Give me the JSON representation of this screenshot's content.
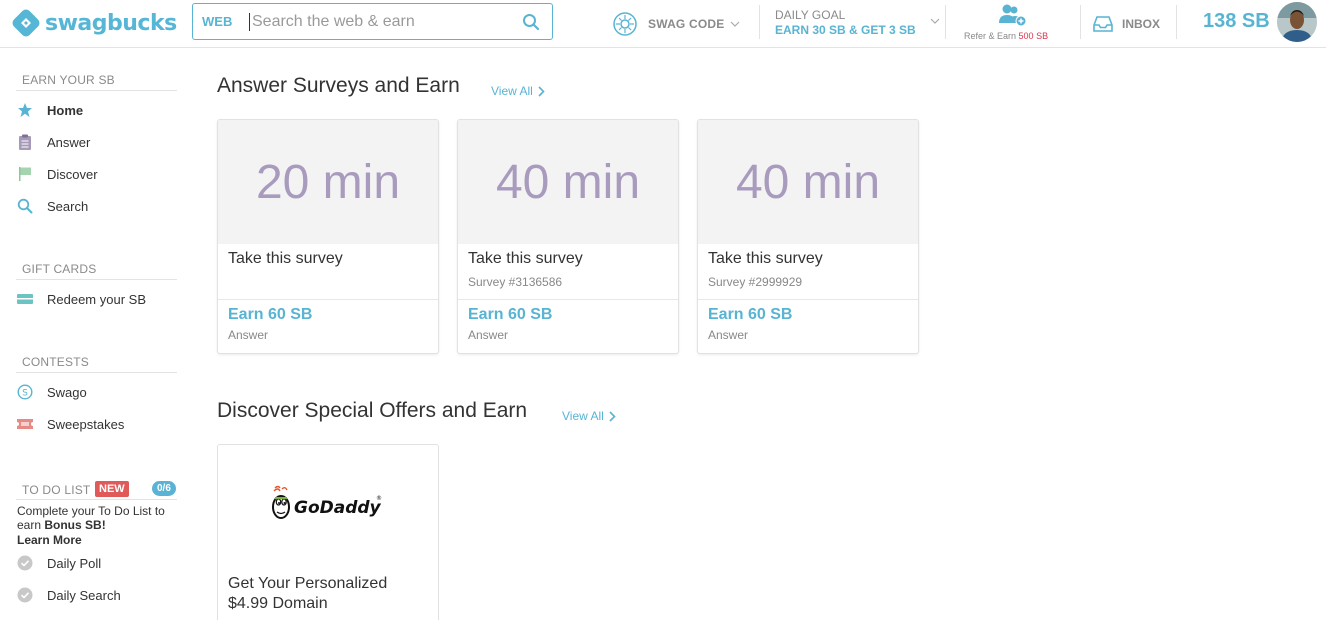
{
  "header": {
    "logo_text": "swagbucks",
    "search": {
      "scope": "WEB",
      "placeholder": "Search the web & earn"
    },
    "swag_code": {
      "label": "SWAG CODE"
    },
    "daily_goal": {
      "title": "DAILY GOAL",
      "value": "EARN 30 SB & GET 3 SB"
    },
    "refer": {
      "label": "Refer & Earn",
      "amount": "500 SB"
    },
    "inbox": {
      "label": "INBOX"
    },
    "balance": "138 SB"
  },
  "sidebar": {
    "earn_heading": "EARN YOUR SB",
    "earn_items": [
      {
        "label": "Home",
        "icon": "star-icon",
        "active": true
      },
      {
        "label": "Answer",
        "icon": "clipboard-icon"
      },
      {
        "label": "Discover",
        "icon": "flag-icon"
      },
      {
        "label": "Search",
        "icon": "search-icon"
      }
    ],
    "gift_heading": "GIFT CARDS",
    "gift_items": [
      {
        "label": "Redeem your SB",
        "icon": "card-icon"
      }
    ],
    "contests_heading": "CONTESTS",
    "contest_items": [
      {
        "label": "Swago",
        "icon": "swago-icon"
      },
      {
        "label": "Sweepstakes",
        "icon": "ticket-icon"
      }
    ],
    "todo": {
      "heading": "TO DO LIST",
      "badge": "NEW",
      "count": "0/6",
      "desc_prefix": "Complete your To Do List to earn ",
      "desc_bold": "Bonus SB!",
      "learn_more": "Learn More",
      "items": [
        {
          "label": "Daily Poll",
          "icon": "check-circle-icon"
        },
        {
          "label": "Daily Search",
          "icon": "check-circle-icon"
        }
      ]
    }
  },
  "surveys": {
    "title": "Answer Surveys and Earn",
    "view_all": "View All",
    "cards": [
      {
        "duration": "20 min",
        "title": "Take this survey",
        "subtitle": "",
        "earn": "Earn 60 SB",
        "type": "Answer"
      },
      {
        "duration": "40 min",
        "title": "Take this survey",
        "subtitle": "Survey #3136586",
        "earn": "Earn 60 SB",
        "type": "Answer"
      },
      {
        "duration": "40 min",
        "title": "Take this survey",
        "subtitle": "Survey #2999929",
        "earn": "Earn 60 SB",
        "type": "Answer"
      }
    ]
  },
  "offers": {
    "title": "Discover Special Offers and Earn",
    "view_all": "View All",
    "cards": [
      {
        "brand": "GoDaddy",
        "title": "Get Your Personalized $4.99 Domain"
      }
    ]
  },
  "colors": {
    "accent": "#58b4d2",
    "hero_text": "#a99bbd",
    "badge_red": "#e05a5a",
    "refer_red": "#d9364c"
  }
}
